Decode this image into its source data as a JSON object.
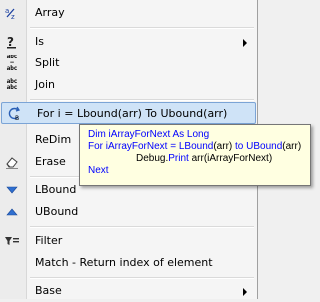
{
  "menu": {
    "items": [
      {
        "label": "Array",
        "icon": "array-icon"
      },
      {
        "label": "Is",
        "icon": "help-icon",
        "submenu": true
      },
      {
        "label": "Split",
        "icon": "split-icon"
      },
      {
        "label": "Join",
        "icon": "join-icon"
      },
      {
        "label": "For i = Lbound(arr) To Ubound(arr)",
        "icon": "loop-icon",
        "active": true
      },
      {
        "label": "ReDim",
        "icon": ""
      },
      {
        "label": "Erase",
        "icon": "eraser-icon"
      },
      {
        "label": "LBound",
        "icon": "arrow-down-icon"
      },
      {
        "label": "UBound",
        "icon": "arrow-up-icon"
      },
      {
        "label": "Filter",
        "icon": "filter-icon"
      },
      {
        "label": "Match - Return index of element",
        "icon": ""
      },
      {
        "label": "Base",
        "icon": "",
        "submenu": true
      }
    ]
  },
  "tooltip": {
    "line1": {
      "kw1": "Dim",
      "var": " iArrayForNext ",
      "kw2": "As Long"
    },
    "line2": {
      "kw1": "For",
      "a": " iArrayForNext = ",
      "kw2": "LBound",
      "b": "(arr) ",
      "kw3": "to",
      "c": " ",
      "kw4": "UBound",
      "d": "(arr)"
    },
    "line3": {
      "a": "Debug.",
      "kw": "Print",
      "b": " arr(iArrayForNext)"
    },
    "line4": {
      "kw": "Next"
    }
  },
  "colors": {
    "keyword": "#0000ff",
    "highlight_bg": "#cfe3f7",
    "highlight_border": "#7ba4d6",
    "tooltip_bg": "#ffffe1"
  }
}
